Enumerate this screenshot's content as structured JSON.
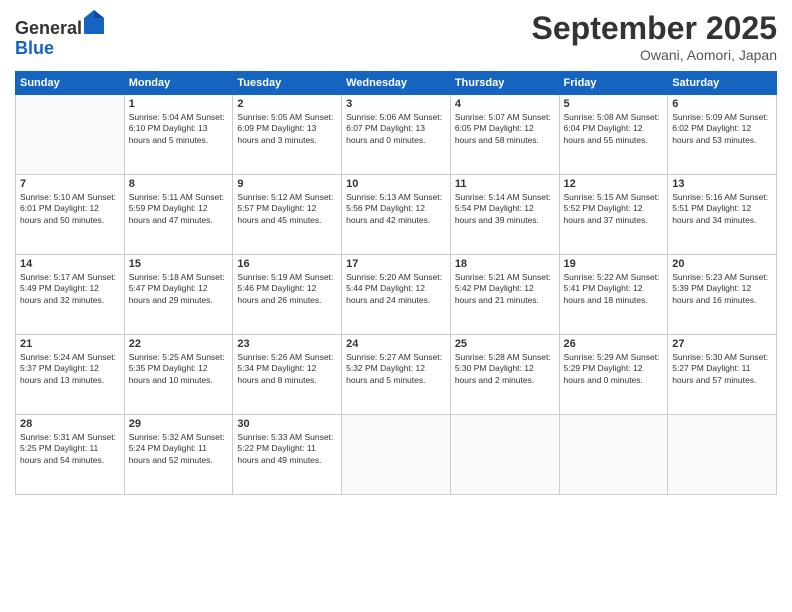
{
  "header": {
    "logo_general": "General",
    "logo_blue": "Blue",
    "month": "September 2025",
    "location": "Owani, Aomori, Japan"
  },
  "weekdays": [
    "Sunday",
    "Monday",
    "Tuesday",
    "Wednesday",
    "Thursday",
    "Friday",
    "Saturday"
  ],
  "weeks": [
    [
      {
        "day": null,
        "info": null
      },
      {
        "day": "1",
        "info": "Sunrise: 5:04 AM\nSunset: 6:10 PM\nDaylight: 13 hours\nand 5 minutes."
      },
      {
        "day": "2",
        "info": "Sunrise: 5:05 AM\nSunset: 6:09 PM\nDaylight: 13 hours\nand 3 minutes."
      },
      {
        "day": "3",
        "info": "Sunrise: 5:06 AM\nSunset: 6:07 PM\nDaylight: 13 hours\nand 0 minutes."
      },
      {
        "day": "4",
        "info": "Sunrise: 5:07 AM\nSunset: 6:05 PM\nDaylight: 12 hours\nand 58 minutes."
      },
      {
        "day": "5",
        "info": "Sunrise: 5:08 AM\nSunset: 6:04 PM\nDaylight: 12 hours\nand 55 minutes."
      },
      {
        "day": "6",
        "info": "Sunrise: 5:09 AM\nSunset: 6:02 PM\nDaylight: 12 hours\nand 53 minutes."
      }
    ],
    [
      {
        "day": "7",
        "info": "Sunrise: 5:10 AM\nSunset: 6:01 PM\nDaylight: 12 hours\nand 50 minutes."
      },
      {
        "day": "8",
        "info": "Sunrise: 5:11 AM\nSunset: 5:59 PM\nDaylight: 12 hours\nand 47 minutes."
      },
      {
        "day": "9",
        "info": "Sunrise: 5:12 AM\nSunset: 5:57 PM\nDaylight: 12 hours\nand 45 minutes."
      },
      {
        "day": "10",
        "info": "Sunrise: 5:13 AM\nSunset: 5:56 PM\nDaylight: 12 hours\nand 42 minutes."
      },
      {
        "day": "11",
        "info": "Sunrise: 5:14 AM\nSunset: 5:54 PM\nDaylight: 12 hours\nand 39 minutes."
      },
      {
        "day": "12",
        "info": "Sunrise: 5:15 AM\nSunset: 5:52 PM\nDaylight: 12 hours\nand 37 minutes."
      },
      {
        "day": "13",
        "info": "Sunrise: 5:16 AM\nSunset: 5:51 PM\nDaylight: 12 hours\nand 34 minutes."
      }
    ],
    [
      {
        "day": "14",
        "info": "Sunrise: 5:17 AM\nSunset: 5:49 PM\nDaylight: 12 hours\nand 32 minutes."
      },
      {
        "day": "15",
        "info": "Sunrise: 5:18 AM\nSunset: 5:47 PM\nDaylight: 12 hours\nand 29 minutes."
      },
      {
        "day": "16",
        "info": "Sunrise: 5:19 AM\nSunset: 5:46 PM\nDaylight: 12 hours\nand 26 minutes."
      },
      {
        "day": "17",
        "info": "Sunrise: 5:20 AM\nSunset: 5:44 PM\nDaylight: 12 hours\nand 24 minutes."
      },
      {
        "day": "18",
        "info": "Sunrise: 5:21 AM\nSunset: 5:42 PM\nDaylight: 12 hours\nand 21 minutes."
      },
      {
        "day": "19",
        "info": "Sunrise: 5:22 AM\nSunset: 5:41 PM\nDaylight: 12 hours\nand 18 minutes."
      },
      {
        "day": "20",
        "info": "Sunrise: 5:23 AM\nSunset: 5:39 PM\nDaylight: 12 hours\nand 16 minutes."
      }
    ],
    [
      {
        "day": "21",
        "info": "Sunrise: 5:24 AM\nSunset: 5:37 PM\nDaylight: 12 hours\nand 13 minutes."
      },
      {
        "day": "22",
        "info": "Sunrise: 5:25 AM\nSunset: 5:35 PM\nDaylight: 12 hours\nand 10 minutes."
      },
      {
        "day": "23",
        "info": "Sunrise: 5:26 AM\nSunset: 5:34 PM\nDaylight: 12 hours\nand 8 minutes."
      },
      {
        "day": "24",
        "info": "Sunrise: 5:27 AM\nSunset: 5:32 PM\nDaylight: 12 hours\nand 5 minutes."
      },
      {
        "day": "25",
        "info": "Sunrise: 5:28 AM\nSunset: 5:30 PM\nDaylight: 12 hours\nand 2 minutes."
      },
      {
        "day": "26",
        "info": "Sunrise: 5:29 AM\nSunset: 5:29 PM\nDaylight: 12 hours\nand 0 minutes."
      },
      {
        "day": "27",
        "info": "Sunrise: 5:30 AM\nSunset: 5:27 PM\nDaylight: 11 hours\nand 57 minutes."
      }
    ],
    [
      {
        "day": "28",
        "info": "Sunrise: 5:31 AM\nSunset: 5:25 PM\nDaylight: 11 hours\nand 54 minutes."
      },
      {
        "day": "29",
        "info": "Sunrise: 5:32 AM\nSunset: 5:24 PM\nDaylight: 11 hours\nand 52 minutes."
      },
      {
        "day": "30",
        "info": "Sunrise: 5:33 AM\nSunset: 5:22 PM\nDaylight: 11 hours\nand 49 minutes."
      },
      {
        "day": null,
        "info": null
      },
      {
        "day": null,
        "info": null
      },
      {
        "day": null,
        "info": null
      },
      {
        "day": null,
        "info": null
      }
    ]
  ]
}
